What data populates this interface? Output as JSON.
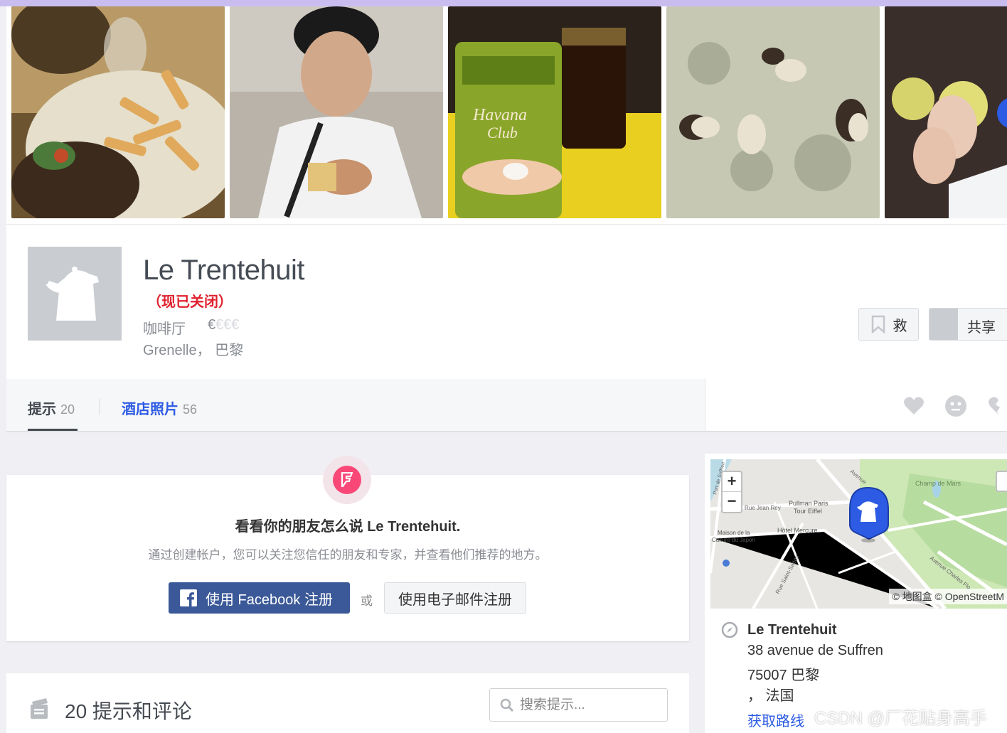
{
  "photos": [
    {
      "name": "steak-frites-photo"
    },
    {
      "name": "man-eating-photo"
    },
    {
      "name": "havana-club-drinks-photo"
    },
    {
      "name": "mushroom-risotto-photo"
    },
    {
      "name": "friends-photo"
    }
  ],
  "venue": {
    "name": "Le Trentehuit",
    "closed": "（现已关闭）",
    "category": "咖啡厅",
    "price_symbol_active": "€",
    "price_symbol_inactive": "€€€",
    "location": "Grenelle， 巴黎",
    "save_label": "救",
    "share_label": "共享"
  },
  "tabs": [
    {
      "label": "提示",
      "count": "20"
    },
    {
      "label": "酒店照片",
      "count": "56"
    }
  ],
  "signup": {
    "title": "看看你的朋友怎么说 Le Trentehuit.",
    "subtitle": "通过创建帐户，您可以关注您信任的朋友和专家，并查看他们推荐的地方。",
    "facebook_label": "使用 Facebook 注册",
    "or_label": "或",
    "email_label": "使用电子邮件注册"
  },
  "tips": {
    "title": "20 提示和评论",
    "search_placeholder": "搜索提示..."
  },
  "map": {
    "zoom_in": "+",
    "zoom_out": "−",
    "attribution": "© 地图盒 © OpenStreetM",
    "labels": {
      "champ_de_mars": "Champ de Mars",
      "pullman": "Pullman Paris",
      "tour_eiffel": "Tour Eiffel",
      "rue_jean_rey": "Rue Jean Rey",
      "hotel_mercure": "Hôtel Mercure",
      "maison_culture_1": "Maison de la",
      "maison_culture_2": "Culture du Japon",
      "avenue": "Avenue",
      "rue_saint_saens": "Rue Saint-Saëns",
      "avenue_charles": "Avenue Charles Flo",
      "port_de_suffren": "Port de Suffren"
    }
  },
  "address": {
    "name": "Le Trentehuit",
    "street": "38 avenue de Suffren",
    "city": "75007 巴黎",
    "country": "，  法国",
    "directions": "获取路线"
  },
  "watermark": "CSDN @厂花贴身高手",
  "colors": {
    "accent_blue": "#2d5be3",
    "closed_red": "#e0212e",
    "facebook_blue": "#3b5998",
    "foursquare_pink": "#f94877"
  }
}
